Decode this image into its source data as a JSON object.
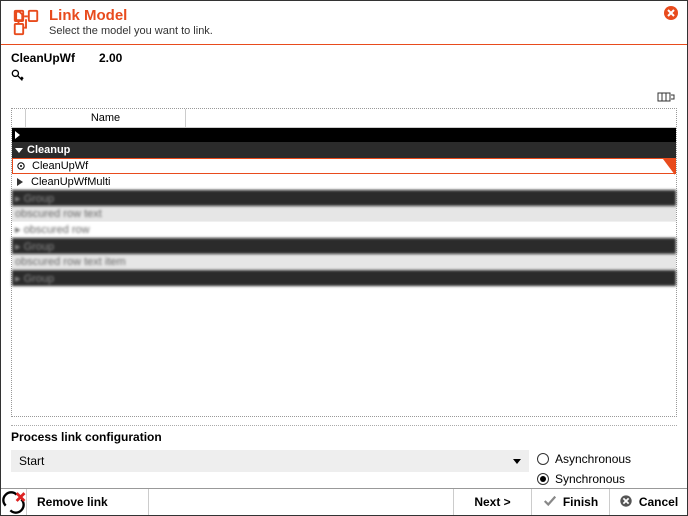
{
  "header": {
    "title": "Link Model",
    "subtitle": "Select the model you want to link."
  },
  "selection": {
    "name": "CleanUpWf",
    "version": "2.00"
  },
  "table": {
    "column_header": "Name",
    "group": "Cleanup",
    "items": [
      {
        "label": "CleanUpWf",
        "selected": true
      },
      {
        "label": "CleanUpWfMulti",
        "selected": false
      }
    ]
  },
  "config": {
    "title": "Process link configuration",
    "select_value": "Start",
    "radio_async": "Asynchronous",
    "radio_sync": "Synchronous",
    "selected_mode": "Synchronous"
  },
  "footer": {
    "remove": "Remove link",
    "next": "Next >",
    "finish": "Finish",
    "cancel": "Cancel"
  }
}
